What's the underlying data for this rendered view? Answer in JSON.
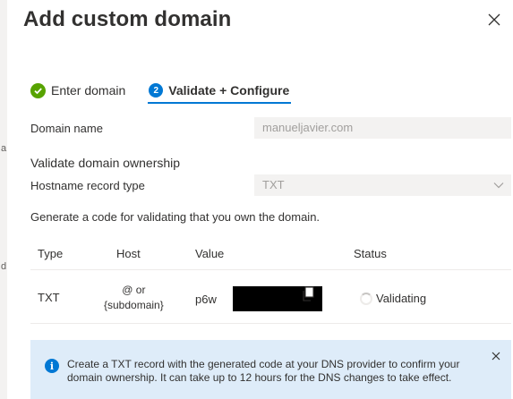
{
  "background_fragments": [
    "a",
    "d"
  ],
  "panel": {
    "title": "Add custom domain"
  },
  "steps": [
    {
      "label": "Enter domain",
      "state": "completed"
    },
    {
      "label": "Validate + Configure",
      "number": "2",
      "state": "active"
    }
  ],
  "form": {
    "domain_name_label": "Domain name",
    "domain_name_value": "manueljavier.com",
    "section_heading": "Validate domain ownership",
    "record_type_label": "Hostname record type",
    "record_type_value": "TXT",
    "hint": "Generate a code for validating that you own the domain."
  },
  "table": {
    "headers": {
      "type": "Type",
      "host": "Host",
      "value": "Value",
      "status": "Status"
    },
    "row": {
      "type": "TXT",
      "host_line1": "@ or",
      "host_line2": "{subdomain}",
      "value_prefix": "p6w",
      "status": "Validating"
    }
  },
  "info": {
    "message": "Create a TXT record with the generated code at your DNS provider to confirm your domain ownership. It can take up to 12 hours for the DNS changes to take effect.",
    "icon_glyph": "i"
  },
  "colors": {
    "accent": "#0078d4",
    "success": "#57a300",
    "info_background": "#deecf9"
  },
  "icons": {
    "close": "close-icon",
    "check": "check-icon",
    "chevron": "chevron-down-icon",
    "copy": "copy-icon",
    "info": "info-icon",
    "spinner": "spinner-icon"
  }
}
